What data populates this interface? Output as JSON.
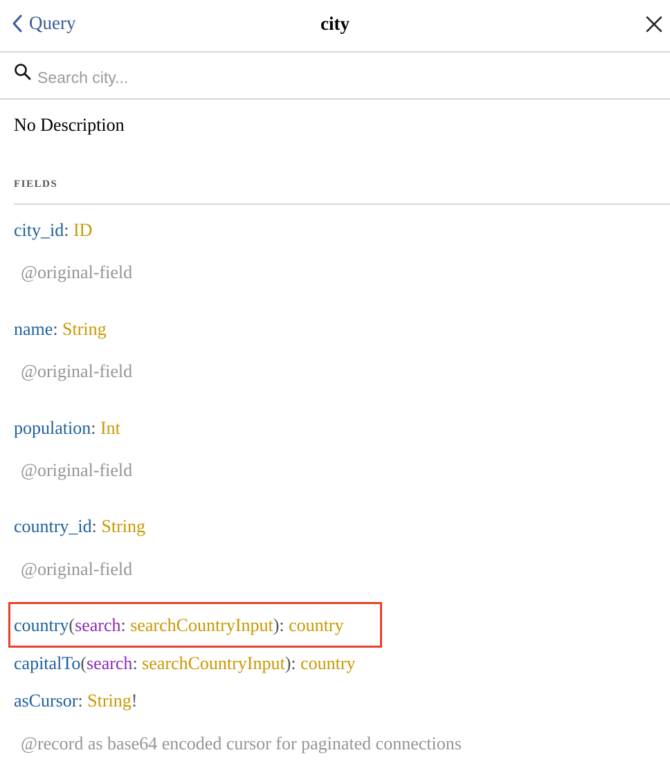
{
  "header": {
    "back_label": "Query",
    "title": "city"
  },
  "search": {
    "placeholder": "Search city..."
  },
  "description": "No Description",
  "fields_section_label": "FIELDS",
  "fields": [
    {
      "name": "city_id",
      "type": "ID",
      "directive": "@original-field"
    },
    {
      "name": "name",
      "type": "String",
      "directive": "@original-field"
    },
    {
      "name": "population",
      "type": "Int",
      "directive": "@original-field"
    },
    {
      "name": "country_id",
      "type": "String",
      "directive": "@original-field"
    },
    {
      "name": "country",
      "arg_name": "search",
      "arg_type": "searchCountryInput",
      "type": "country"
    },
    {
      "name": "capitalTo",
      "arg_name": "search",
      "arg_type": "searchCountryInput",
      "type": "country"
    },
    {
      "name": "asCursor",
      "type": "String",
      "non_null": "!",
      "directive": "@record as base64 encoded cursor for paginated connections"
    }
  ],
  "punct": {
    "colon": ": ",
    "open_paren": "(",
    "close_paren_colon": "): "
  },
  "colors": {
    "field_name": "#1f61a0",
    "type_name": "#ca9800",
    "arg_name": "#8b2bb9",
    "directive": "#959595",
    "highlight": "#e8412a"
  },
  "icons": [
    "chevron-left-icon",
    "close-icon",
    "search-icon"
  ]
}
